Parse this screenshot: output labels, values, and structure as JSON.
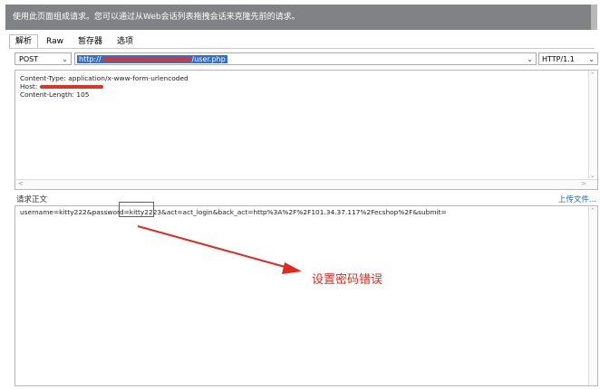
{
  "banner": {
    "text": "使用此页面组成请求。您可以通过从Web会话列表拖拽会话来克隆先前的请求。"
  },
  "tabs": [
    "解析",
    "Raw",
    "暂存器",
    "选项"
  ],
  "request": {
    "method": "POST",
    "url_prefix": "http://",
    "url_suffix": "/user.php",
    "protocol": "HTTP/1.1"
  },
  "headers": {
    "line1": "Content-Type: application/x-www-form-urlencoded",
    "line2_label": "Host:",
    "line3": "Content-Length: 105"
  },
  "body": {
    "label": "请求正文",
    "upload_link": "上传文件...",
    "text_before": "username=kitty222&password=",
    "password_value": "kitty2223",
    "text_after": "&act=act_login&back_act=http%3A%2F%2F101.34.37.117%2Fecshop%2F&submit="
  },
  "annotation": {
    "text": "设置密码错误"
  },
  "colors": {
    "annotation": "#e0281f",
    "url_highlight": "#2f6fd6",
    "banner": "#808285"
  }
}
